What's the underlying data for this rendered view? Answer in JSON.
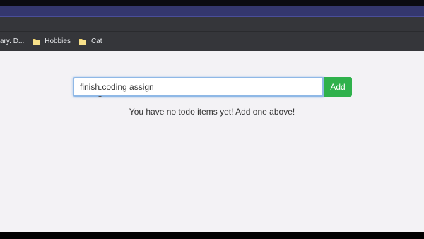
{
  "bookmarks_bar": {
    "items": [
      {
        "label": "ary. D...",
        "icon": "folder-icon"
      },
      {
        "label": "Hobbies",
        "icon": "folder-icon"
      },
      {
        "label": "Cat",
        "icon": "folder-icon"
      }
    ]
  },
  "todo_form": {
    "input_value": "finish coding assign",
    "add_label": "Add"
  },
  "empty_state": {
    "message": "You have no todo items yet! Add one above!"
  },
  "colors": {
    "add_button": "#2fb14c",
    "input_focus_border": "#8fb8e6",
    "page_background": "#f3f2f5",
    "browser_chrome": "#35363a"
  }
}
